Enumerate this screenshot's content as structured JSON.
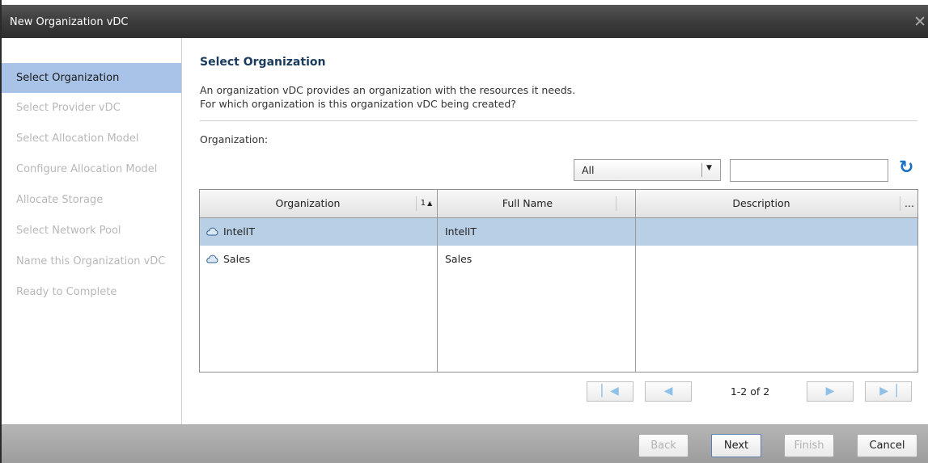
{
  "window": {
    "title": "New Organization vDC"
  },
  "sidebar": {
    "items": [
      {
        "label": "Select Organization"
      },
      {
        "label": "Select Provider vDC"
      },
      {
        "label": "Select Allocation Model"
      },
      {
        "label": "Configure Allocation Model"
      },
      {
        "label": "Allocate Storage"
      },
      {
        "label": "Select Network Pool"
      },
      {
        "label": "Name this Organization vDC"
      },
      {
        "label": "Ready to Complete"
      }
    ]
  },
  "main": {
    "heading": "Select Organization",
    "description_line1": "An organization vDC provides an organization with the resources it needs.",
    "description_line2": "For which organization is this organization vDC being created?",
    "organization_label": "Organization:",
    "filter": {
      "selected": "All"
    },
    "search": {
      "value": "",
      "placeholder": ""
    }
  },
  "table": {
    "columns": [
      {
        "label": "Organization",
        "sort": "1"
      },
      {
        "label": "Full Name"
      },
      {
        "label": "Description"
      }
    ],
    "rows": [
      {
        "organization": "IntelIT",
        "full_name": "IntelIT",
        "description": ""
      },
      {
        "organization": "Sales",
        "full_name": "Sales",
        "description": ""
      }
    ],
    "more_label": "..."
  },
  "pagination": {
    "info": "1-2 of 2"
  },
  "footer": {
    "back_label": "Back",
    "next_label": "Next",
    "finish_label": "Finish",
    "cancel_label": "Cancel"
  },
  "icons": {
    "close": "close-icon",
    "cloud": "cloud-icon",
    "refresh": "refresh-icon",
    "first": "first-page-icon",
    "prev": "previous-page-icon",
    "next": "next-page-icon",
    "last": "last-page-icon"
  },
  "colors": {
    "selected_nav": "#a9c2e8",
    "selected_row": "#b8cfe6",
    "heading": "#1a3a5c",
    "refresh": "#1a6fc4"
  }
}
